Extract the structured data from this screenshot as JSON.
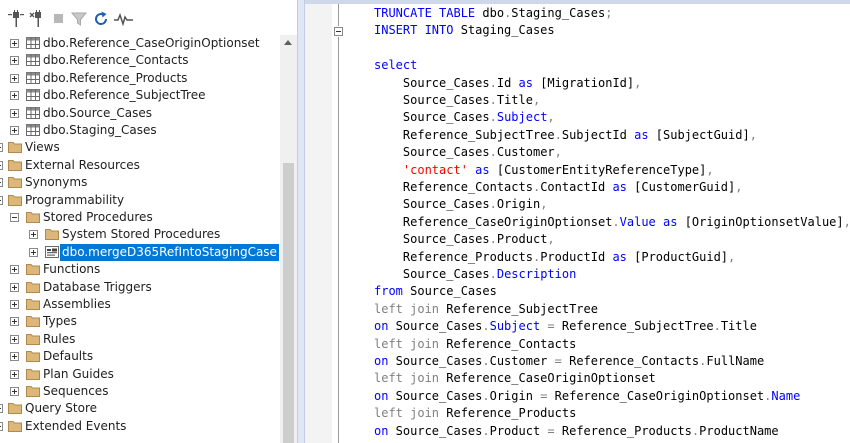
{
  "colors": {
    "keyword": "#0000FF",
    "operator": "#808080",
    "string": "#FF0000",
    "system_function": "#FF00FF",
    "column": "#008080",
    "selection": "#0078D7"
  },
  "toolbar": {
    "buttons": [
      {
        "name": "connect-icon"
      },
      {
        "name": "disconnect-icon"
      },
      {
        "name": "stop-icon"
      },
      {
        "name": "filter-icon"
      },
      {
        "name": "refresh-icon"
      },
      {
        "name": "activity-monitor-icon"
      }
    ]
  },
  "tree": {
    "nodes": [
      {
        "label": "dbo.Reference_CaseOriginOptionset",
        "icon": "table-icon",
        "expander": "plus",
        "level": 1
      },
      {
        "label": "dbo.Reference_Contacts",
        "icon": "table-icon",
        "expander": "plus",
        "level": 1
      },
      {
        "label": "dbo.Reference_Products",
        "icon": "table-icon",
        "expander": "plus",
        "level": 1
      },
      {
        "label": "dbo.Reference_SubjectTree",
        "icon": "table-icon",
        "expander": "plus",
        "level": 1
      },
      {
        "label": "dbo.Source_Cases",
        "icon": "table-icon",
        "expander": "plus",
        "level": 1
      },
      {
        "label": "dbo.Staging_Cases",
        "icon": "table-icon",
        "expander": "plus",
        "level": 1
      },
      {
        "label": "Views",
        "icon": "folder-icon",
        "expander": "plus",
        "level": 0
      },
      {
        "label": "External Resources",
        "icon": "folder-icon",
        "expander": "plus",
        "level": 0
      },
      {
        "label": "Synonyms",
        "icon": "folder-icon",
        "expander": "plus",
        "level": 0
      },
      {
        "label": "Programmability",
        "icon": "folder-icon",
        "expander": "minus",
        "level": 0
      },
      {
        "label": "Stored Procedures",
        "icon": "folder-icon",
        "expander": "minus",
        "level": 1
      },
      {
        "label": "System Stored Procedures",
        "icon": "folder-icon",
        "expander": "plus",
        "level": 2
      },
      {
        "label": "dbo.mergeD365RefIntoStagingCase",
        "icon": "stored-procedure-icon",
        "expander": "plus",
        "level": 2,
        "selected": true
      },
      {
        "label": "Functions",
        "icon": "folder-icon",
        "expander": "plus",
        "level": 1
      },
      {
        "label": "Database Triggers",
        "icon": "folder-icon",
        "expander": "plus",
        "level": 1
      },
      {
        "label": "Assemblies",
        "icon": "folder-icon",
        "expander": "plus",
        "level": 1
      },
      {
        "label": "Types",
        "icon": "folder-icon",
        "expander": "plus",
        "level": 1
      },
      {
        "label": "Rules",
        "icon": "folder-icon",
        "expander": "plus",
        "level": 1
      },
      {
        "label": "Defaults",
        "icon": "folder-icon",
        "expander": "plus",
        "level": 1
      },
      {
        "label": "Plan Guides",
        "icon": "folder-icon",
        "expander": "plus",
        "level": 1
      },
      {
        "label": "Sequences",
        "icon": "folder-icon",
        "expander": "plus",
        "level": 1
      },
      {
        "label": "Query Store",
        "icon": "folder-icon",
        "expander": "plus",
        "level": 0
      },
      {
        "label": "Extended Events",
        "icon": "folder-icon",
        "expander": "plus",
        "level": 0
      }
    ]
  },
  "editor": {
    "lines": [
      {
        "indent": 0,
        "tokens": [
          {
            "t": "TRUNCATE TABLE",
            "c": "kw"
          },
          {
            "t": " dbo",
            "c": ""
          },
          {
            "t": ".",
            "c": "gray"
          },
          {
            "t": "Staging_Cases",
            "c": ""
          },
          {
            "t": ";",
            "c": "gray"
          }
        ]
      },
      {
        "indent": 0,
        "tokens": [
          {
            "t": "INSERT INTO",
            "c": "kw"
          },
          {
            "t": " Staging_Cases",
            "c": ""
          }
        ]
      },
      {
        "indent": 0,
        "tokens": []
      },
      {
        "indent": 0,
        "tokens": [
          {
            "t": "select",
            "c": "kw"
          }
        ]
      },
      {
        "indent": 4,
        "tokens": [
          {
            "t": "Source_Cases",
            "c": ""
          },
          {
            "t": ".",
            "c": "gray"
          },
          {
            "t": "Id ",
            "c": ""
          },
          {
            "t": "as",
            "c": "kw"
          },
          {
            "t": " [MigrationId]",
            "c": ""
          },
          {
            "t": ",",
            "c": "gray"
          }
        ]
      },
      {
        "indent": 4,
        "tokens": [
          {
            "t": "Source_Cases",
            "c": ""
          },
          {
            "t": ".",
            "c": "gray"
          },
          {
            "t": "Title",
            "c": ""
          },
          {
            "t": ",",
            "c": "gray"
          }
        ]
      },
      {
        "indent": 4,
        "tokens": [
          {
            "t": "Source_Cases",
            "c": ""
          },
          {
            "t": ".",
            "c": "gray"
          },
          {
            "t": "Subject",
            "c": "kw"
          },
          {
            "t": ",",
            "c": "gray"
          }
        ]
      },
      {
        "indent": 4,
        "tokens": [
          {
            "t": "Reference_SubjectTree",
            "c": ""
          },
          {
            "t": ".",
            "c": "gray"
          },
          {
            "t": "SubjectId ",
            "c": ""
          },
          {
            "t": "as",
            "c": "kw"
          },
          {
            "t": " [SubjectGuid]",
            "c": ""
          },
          {
            "t": ",",
            "c": "gray"
          }
        ]
      },
      {
        "indent": 4,
        "tokens": [
          {
            "t": "Source_Cases",
            "c": ""
          },
          {
            "t": ".",
            "c": "gray"
          },
          {
            "t": "Customer",
            "c": ""
          },
          {
            "t": ",",
            "c": "gray"
          }
        ]
      },
      {
        "indent": 4,
        "tokens": [
          {
            "t": "'contact'",
            "c": "str"
          },
          {
            "t": " as",
            "c": "kw"
          },
          {
            "t": " [CustomerEntityReferenceType]",
            "c": ""
          },
          {
            "t": ",",
            "c": "gray"
          }
        ]
      },
      {
        "indent": 4,
        "tokens": [
          {
            "t": "Reference_Contacts",
            "c": ""
          },
          {
            "t": ".",
            "c": "gray"
          },
          {
            "t": "ContactId ",
            "c": ""
          },
          {
            "t": "as",
            "c": "kw"
          },
          {
            "t": " [CustomerGuid]",
            "c": ""
          },
          {
            "t": ",",
            "c": "gray"
          }
        ]
      },
      {
        "indent": 4,
        "tokens": [
          {
            "t": "Source_Cases",
            "c": ""
          },
          {
            "t": ".",
            "c": "gray"
          },
          {
            "t": "Origin",
            "c": ""
          },
          {
            "t": ",",
            "c": "gray"
          }
        ]
      },
      {
        "indent": 4,
        "tokens": [
          {
            "t": "Reference_CaseOriginOptionset",
            "c": ""
          },
          {
            "t": ".",
            "c": "gray"
          },
          {
            "t": "Value",
            "c": "kw"
          },
          {
            "t": " as",
            "c": "kw"
          },
          {
            "t": " [OriginOptionsetValue]",
            "c": ""
          },
          {
            "t": ",",
            "c": "gray"
          }
        ]
      },
      {
        "indent": 4,
        "tokens": [
          {
            "t": "Source_Cases",
            "c": ""
          },
          {
            "t": ".",
            "c": "gray"
          },
          {
            "t": "Product",
            "c": ""
          },
          {
            "t": ",",
            "c": "gray"
          }
        ]
      },
      {
        "indent": 4,
        "tokens": [
          {
            "t": "Reference_Products",
            "c": ""
          },
          {
            "t": ".",
            "c": "gray"
          },
          {
            "t": "ProductId ",
            "c": ""
          },
          {
            "t": "as",
            "c": "kw"
          },
          {
            "t": " [ProductGuid]",
            "c": ""
          },
          {
            "t": ",",
            "c": "gray"
          }
        ]
      },
      {
        "indent": 4,
        "tokens": [
          {
            "t": "Source_Cases",
            "c": ""
          },
          {
            "t": ".",
            "c": "gray"
          },
          {
            "t": "Description",
            "c": "kw"
          }
        ]
      },
      {
        "indent": 0,
        "tokens": [
          {
            "t": "from",
            "c": "kw"
          },
          {
            "t": " Source_Cases",
            "c": ""
          }
        ]
      },
      {
        "indent": 0,
        "tokens": [
          {
            "t": "left join",
            "c": "gray"
          },
          {
            "t": " Reference_SubjectTree",
            "c": ""
          }
        ]
      },
      {
        "indent": 0,
        "tokens": [
          {
            "t": "on",
            "c": "kw"
          },
          {
            "t": " Source_Cases",
            "c": ""
          },
          {
            "t": ".",
            "c": "gray"
          },
          {
            "t": "Subject",
            "c": "kw"
          },
          {
            "t": " = ",
            "c": "gray"
          },
          {
            "t": "Reference_SubjectTree",
            "c": ""
          },
          {
            "t": ".",
            "c": "gray"
          },
          {
            "t": "Title",
            "c": ""
          }
        ]
      },
      {
        "indent": 0,
        "tokens": [
          {
            "t": "left join",
            "c": "gray"
          },
          {
            "t": " Reference_Contacts",
            "c": ""
          }
        ]
      },
      {
        "indent": 0,
        "tokens": [
          {
            "t": "on",
            "c": "kw"
          },
          {
            "t": " Source_Cases",
            "c": ""
          },
          {
            "t": ".",
            "c": "gray"
          },
          {
            "t": "Customer ",
            "c": ""
          },
          {
            "t": "=",
            "c": "gray"
          },
          {
            "t": " Reference_Contacts",
            "c": ""
          },
          {
            "t": ".",
            "c": "gray"
          },
          {
            "t": "FullName",
            "c": ""
          }
        ]
      },
      {
        "indent": 0,
        "tokens": [
          {
            "t": "left join",
            "c": "gray"
          },
          {
            "t": " Reference_CaseOriginOptionset",
            "c": ""
          }
        ]
      },
      {
        "indent": 0,
        "tokens": [
          {
            "t": "on",
            "c": "kw"
          },
          {
            "t": " Source_Cases",
            "c": ""
          },
          {
            "t": ".",
            "c": "gray"
          },
          {
            "t": "Origin ",
            "c": ""
          },
          {
            "t": "=",
            "c": "gray"
          },
          {
            "t": " Reference_CaseOriginOptionset",
            "c": ""
          },
          {
            "t": ".",
            "c": "gray"
          },
          {
            "t": "Name",
            "c": "kw"
          }
        ]
      },
      {
        "indent": 0,
        "tokens": [
          {
            "t": "left join",
            "c": "gray"
          },
          {
            "t": " Reference_Products",
            "c": ""
          }
        ]
      },
      {
        "indent": 0,
        "tokens": [
          {
            "t": "on",
            "c": "kw"
          },
          {
            "t": " Source_Cases",
            "c": ""
          },
          {
            "t": ".",
            "c": "gray"
          },
          {
            "t": "Product ",
            "c": ""
          },
          {
            "t": "=",
            "c": "gray"
          },
          {
            "t": " Reference_Products",
            "c": ""
          },
          {
            "t": ".",
            "c": "gray"
          },
          {
            "t": "ProductName",
            "c": ""
          }
        ]
      }
    ]
  }
}
